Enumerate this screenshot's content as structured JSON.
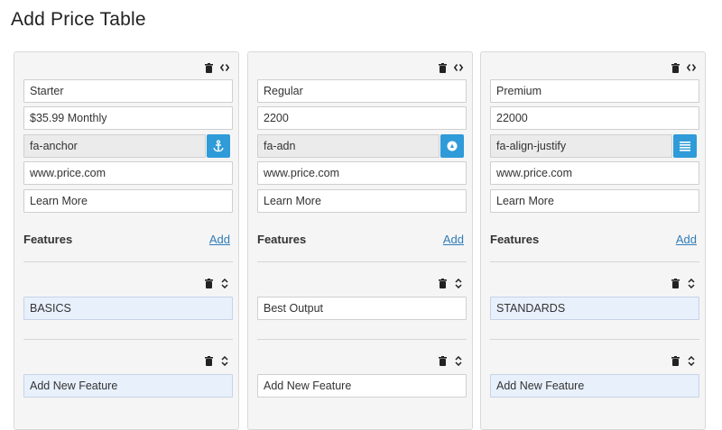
{
  "page": {
    "title": "Add Price Table"
  },
  "accent_color": "#2f9bd8",
  "link_color": "#2e7cb8",
  "columns": [
    {
      "title": "Starter",
      "price": "$35.99 Monthly",
      "icon": "fa-anchor",
      "icon_semantic": "anchor-icon",
      "url": "www.price.com",
      "button_text": "Learn More",
      "features_label": "Features",
      "add_label": "Add",
      "features": [
        "BASICS",
        "Add New Feature"
      ]
    },
    {
      "title": "Regular",
      "price": "2200",
      "icon": "fa-adn",
      "icon_semantic": "adn-icon",
      "url": "www.price.com",
      "button_text": "Learn More",
      "features_label": "Features",
      "add_label": "Add",
      "features": [
        "Best Output",
        "Add New Feature"
      ]
    },
    {
      "title": "Premium",
      "price": "22000",
      "icon": "fa-align-justify",
      "icon_semantic": "align-justify-icon",
      "url": "www.price.com",
      "button_text": "Learn More",
      "features_label": "Features",
      "add_label": "Add",
      "features": [
        "STANDARDS",
        "Add New Feature"
      ]
    }
  ]
}
